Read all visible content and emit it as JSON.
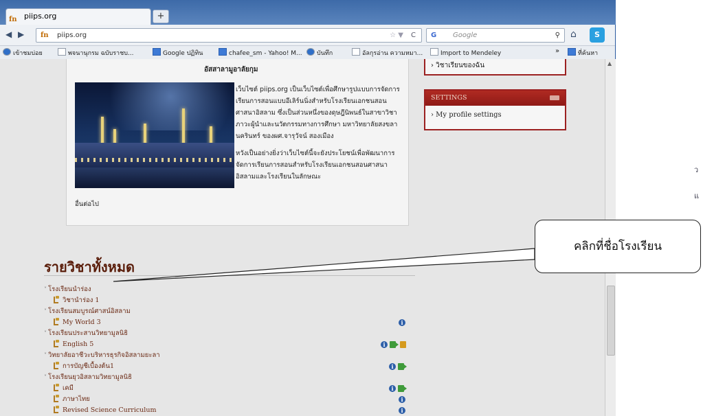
{
  "browser": {
    "tab_title": "piips.org",
    "tab_favicon": "fn",
    "new_tab": "+",
    "back": "◀",
    "forward": "▶",
    "url": "piips.org",
    "url_star": "☆ ▼",
    "refresh": "C",
    "search_engine": "G",
    "search_placeholder": "Google",
    "search_icon": "⚲",
    "home_icon": "⌂",
    "skype_icon": "S"
  },
  "bookmarks": {
    "items": [
      "เข้าชมบ่อย",
      "พจนานุกรม ฉบับราชบ...",
      "Google ปฏิทิน",
      "chafee_sm - Yahoo! M...",
      "บันทึก",
      "อัลกุรอ่าน ความหมา...",
      "Import to Mendeley"
    ],
    "more": "»",
    "last": "ที่ค้นหา"
  },
  "right_strip": {
    "g1": "ว",
    "g2": "แ"
  },
  "main": {
    "heading": "อัสสาลามูอาลัยกุม",
    "para1": "เว็บไซต์ piips.org เป็นเว็บไซต์เพื่อศึกษารูปแบบการจัดการเรียนการสอนแบบอีเลิร์นนิ่งสำหรับโรงเรียนเอกชนสอนศาสนาอิสลาม ซึ่งเป็นส่วนหนึ่งของดุษฎีนิพนธ์ในสาขาวิชาภาวะผู้นำและนวัตกรรมทางการศึกษา มหาวิทยาลัยสงขลานครินทร์ ของผศ.จารุวัจน์ สองเมือง",
    "para2": "หวังเป็นอย่างยิ่งว่าเว็บไซต์นี้จะยังประโยชน์เพื่อพัฒนาการจัดการเรียนการสอนสำหรับโรงเรียนเอกชนสอนศาสนาอิสลามและโรงเรียนในลักษณะ",
    "tail": "อื่นต่อไป"
  },
  "sidebar": {
    "my_classes": "› วิชาเรียนของฉัน",
    "settings_title": "SETTINGS",
    "settings_link": "› My profile settings"
  },
  "courses": {
    "title": "รายวิชาทั้งหมด",
    "caret": "˅",
    "rows": [
      {
        "type": "cat",
        "label": "โรงเรียนนำร่อง"
      },
      {
        "type": "course",
        "label": "วิชานำร่อง 1"
      },
      {
        "type": "cat",
        "label": "โรงเรียนสมบูรณ์ศาสน์อิสลาม"
      },
      {
        "type": "course",
        "label": "My World 3"
      },
      {
        "type": "cat",
        "label": "โรงเรียนประสานวิทยามูลนิธิ"
      },
      {
        "type": "course",
        "label": "English 5"
      },
      {
        "type": "cat",
        "label": "วิทยาลัยอาชีวะบริหารธุรกิจอิสลามยะลา"
      },
      {
        "type": "course",
        "label": "การบัญชีเบื้องต้น1"
      },
      {
        "type": "cat",
        "label": "โรงเรียนยุวอิสลามวิทยามูลนิธิ"
      },
      {
        "type": "course",
        "label": "เคมี"
      },
      {
        "type": "course",
        "label": "ภาษาไทย"
      },
      {
        "type": "course",
        "label": "Revised Science Curriculum"
      }
    ],
    "info_symbol": "i"
  },
  "callout": {
    "text": "คลิกที่ชื่อโรงเรียน"
  }
}
